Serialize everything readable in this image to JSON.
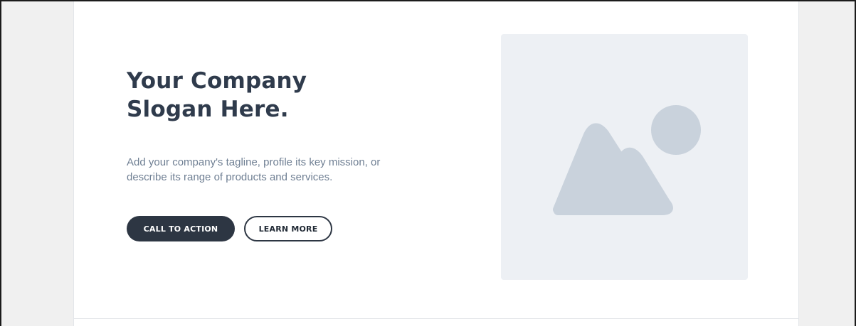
{
  "hero": {
    "title_line1": "Your Company",
    "title_line2": "Slogan Here.",
    "tagline_line1": "Add your company's tagline, profile its key mission, or",
    "tagline_line2": "describe its range of products and services."
  },
  "buttons": {
    "primary_label": "CALL TO ACTION",
    "secondary_label": "LEARN MORE"
  },
  "image": {
    "icon": "image-placeholder-icon",
    "background_color": "#edf0f4",
    "shape_color": "#c9d2dc"
  },
  "colors": {
    "title": "#2f3b4c",
    "tagline": "#6f7f93",
    "primary_button": "#2d3643",
    "page_background": "#f0f0f0"
  }
}
